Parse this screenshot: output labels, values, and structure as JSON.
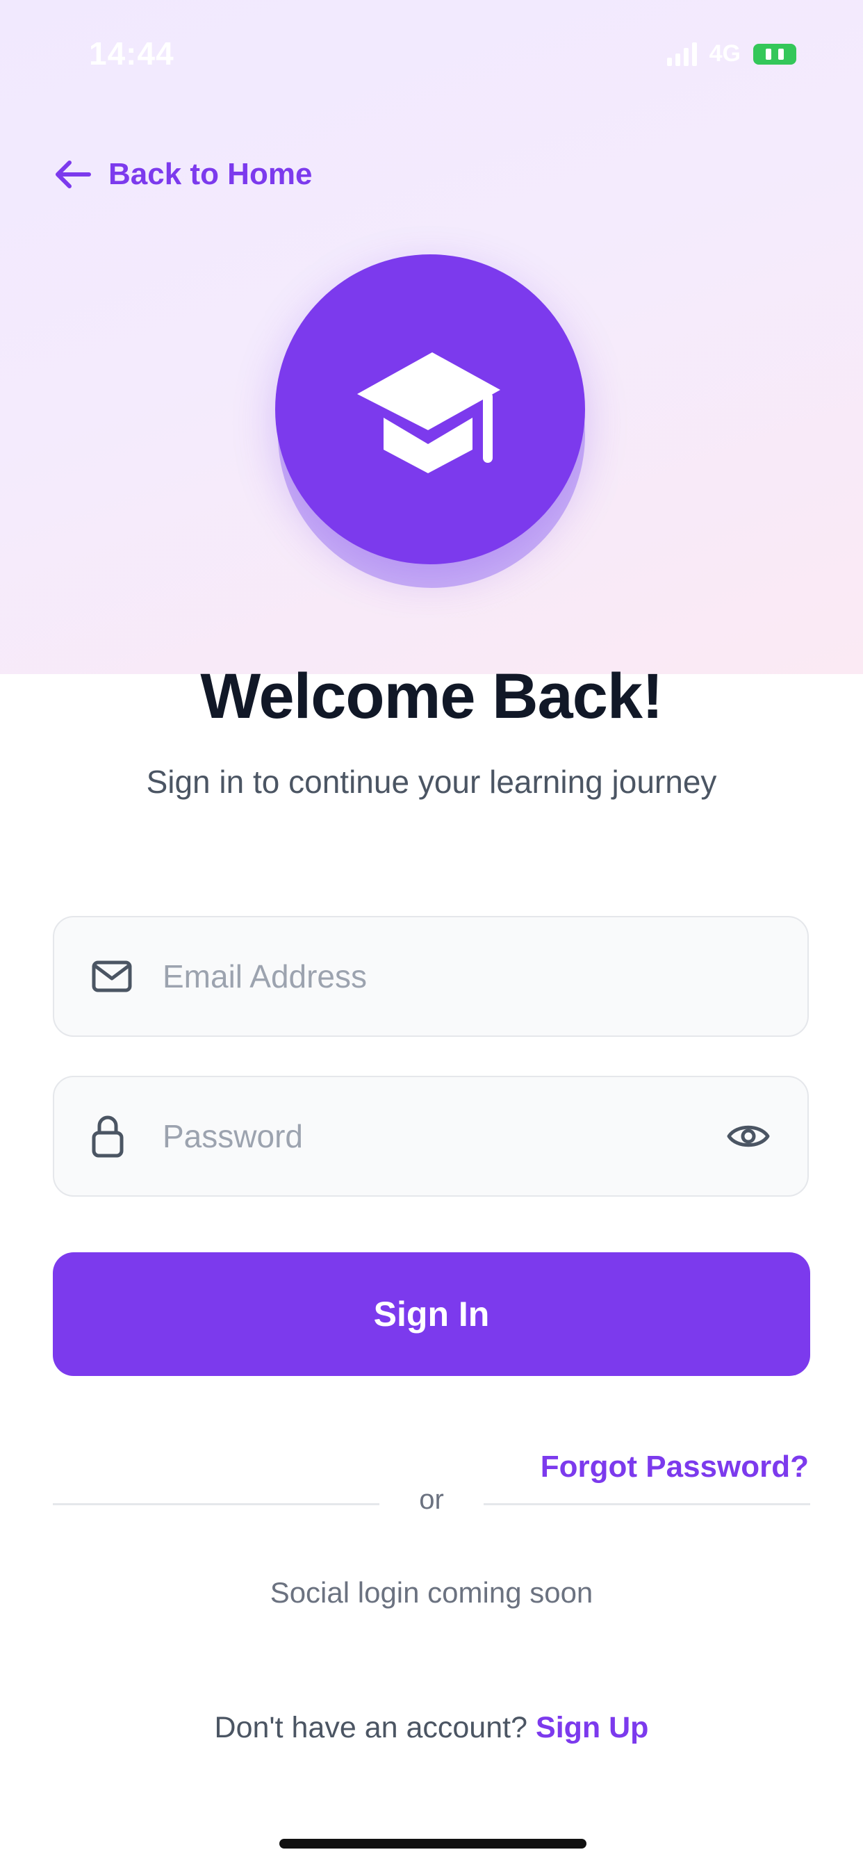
{
  "status_bar": {
    "time": "14:44",
    "network": "4G"
  },
  "header": {
    "back_label": "Back to Home"
  },
  "hero": {
    "logo_icon": "graduation-cap-icon",
    "accent_color": "#7c3aed"
  },
  "welcome": {
    "title": "Welcome Back!",
    "subtitle": "Sign in to continue your learning journey"
  },
  "form": {
    "email": {
      "placeholder": "Email Address",
      "value": "",
      "icon": "mail-icon"
    },
    "password": {
      "placeholder": "Password",
      "value": "",
      "icon": "lock-icon",
      "toggle_icon": "eye-icon"
    },
    "submit_label": "Sign In",
    "forgot_label": "Forgot Password?"
  },
  "divider": {
    "label": "or"
  },
  "social": {
    "text": "Social login coming soon"
  },
  "signup": {
    "prompt": "Don't have an account?",
    "link_label": "Sign Up"
  }
}
